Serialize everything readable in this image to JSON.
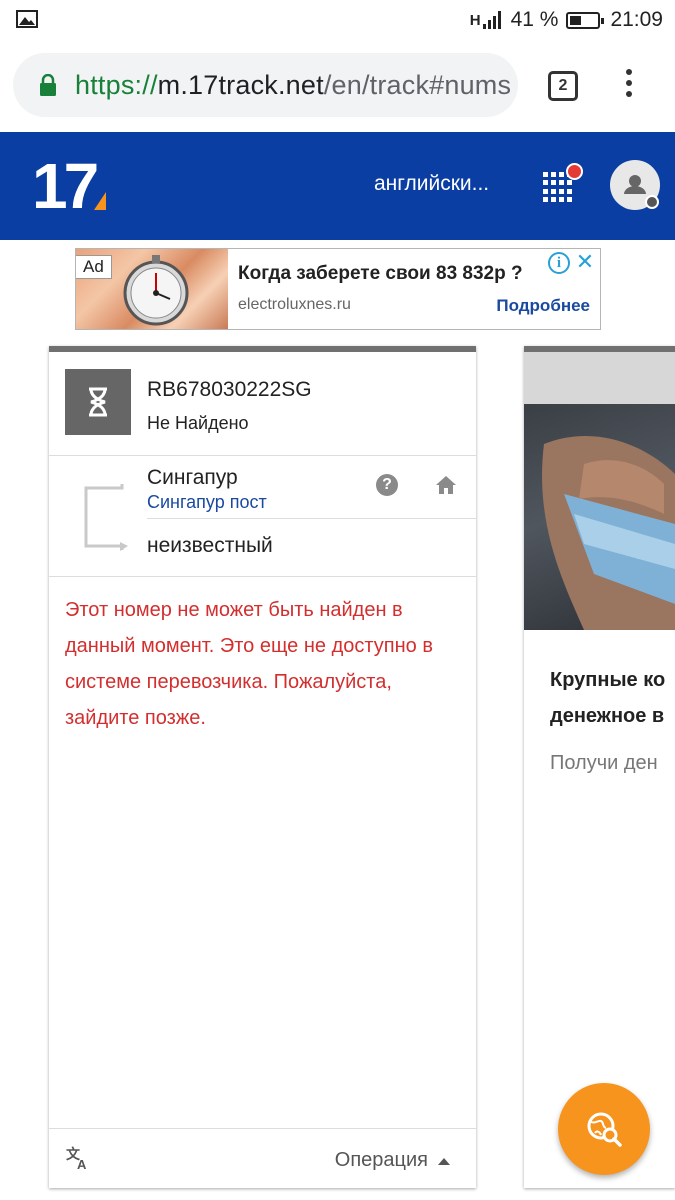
{
  "status_bar": {
    "network": "H",
    "battery_percent": "41 %",
    "battery_level": 0.41,
    "time": "21:09"
  },
  "browser": {
    "url_scheme": "https://",
    "url_host": "m.17track.net",
    "url_path": "/en/track#nums",
    "tab_count": "2"
  },
  "header": {
    "logo_text": "17",
    "language": "английски...",
    "brand_color": "#0b3ea3",
    "accent_color": "#f7941d"
  },
  "ad": {
    "badge": "Ad",
    "title": "Когда заберете свои 83 832р ?",
    "domain": "electroluxnes.ru",
    "cta": "Подробнее"
  },
  "tracking_card": {
    "number": "RB678030222SG",
    "status": "Не Найдено",
    "origin_country": "Сингапур",
    "origin_carrier": "Сингапур пост",
    "destination": "неизвестный",
    "message": "Этот номер не может быть найден в данный момент. Это еще не доступно в системе перевозчика. Пожалуйста, зайдите позже.",
    "footer_action": "Операция",
    "message_color": "#d32f2f"
  },
  "side_card": {
    "title_line1": "Крупные ко",
    "title_line2": "денежное в",
    "subtitle": "Получи ден"
  }
}
